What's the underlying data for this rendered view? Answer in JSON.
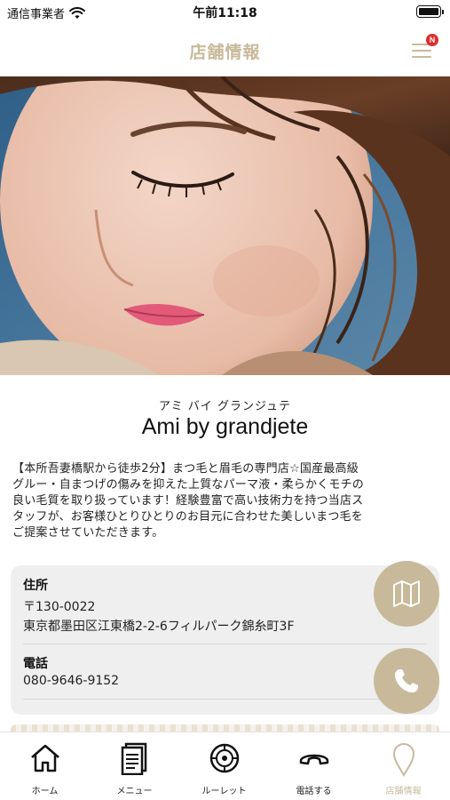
{
  "status_bar": {
    "carrier": "通信事業者",
    "time": "午前11:18"
  },
  "header": {
    "title": "店舗情報",
    "menu_badge": "N",
    "accent_color": "#c8b99a"
  },
  "shop": {
    "name_kana": "アミ バイ グランジュテ",
    "name": "Ami by grandjete",
    "description_lines": [
      "【本所吾妻橋駅から徒歩2分】まつ毛と眉毛の専門店☆国産最高級",
      "グルー・自まつげの傷みを抑えた上質なパーマ液・柔らかくモチの",
      "良い毛質を取り扱っています！経験豊富で高い技術力を持つ当店ス",
      "タッフが、お客様ひとりひとりのお目元に合わせた美しいまつ毛を",
      "ご提案させていただきます。"
    ]
  },
  "info": {
    "address_label": "住所",
    "postal_code": "〒130-0022",
    "address": "東京都墨田区江東橋2-2-6フィルパーク錦糸町3F",
    "phone_label": "電話",
    "phone": "080-9646-9152",
    "map_icon": "map-icon",
    "call_icon": "phone-icon"
  },
  "tabbar": {
    "items": [
      {
        "label": "ホーム",
        "icon": "home-icon"
      },
      {
        "label": "メニュー",
        "icon": "menu-document-icon"
      },
      {
        "label": "ルーレット",
        "icon": "roulette-icon"
      },
      {
        "label": "電話する",
        "icon": "phone-handset-icon"
      },
      {
        "label": "店舗情報",
        "icon": "location-pin-icon"
      }
    ],
    "active_index": 4
  }
}
